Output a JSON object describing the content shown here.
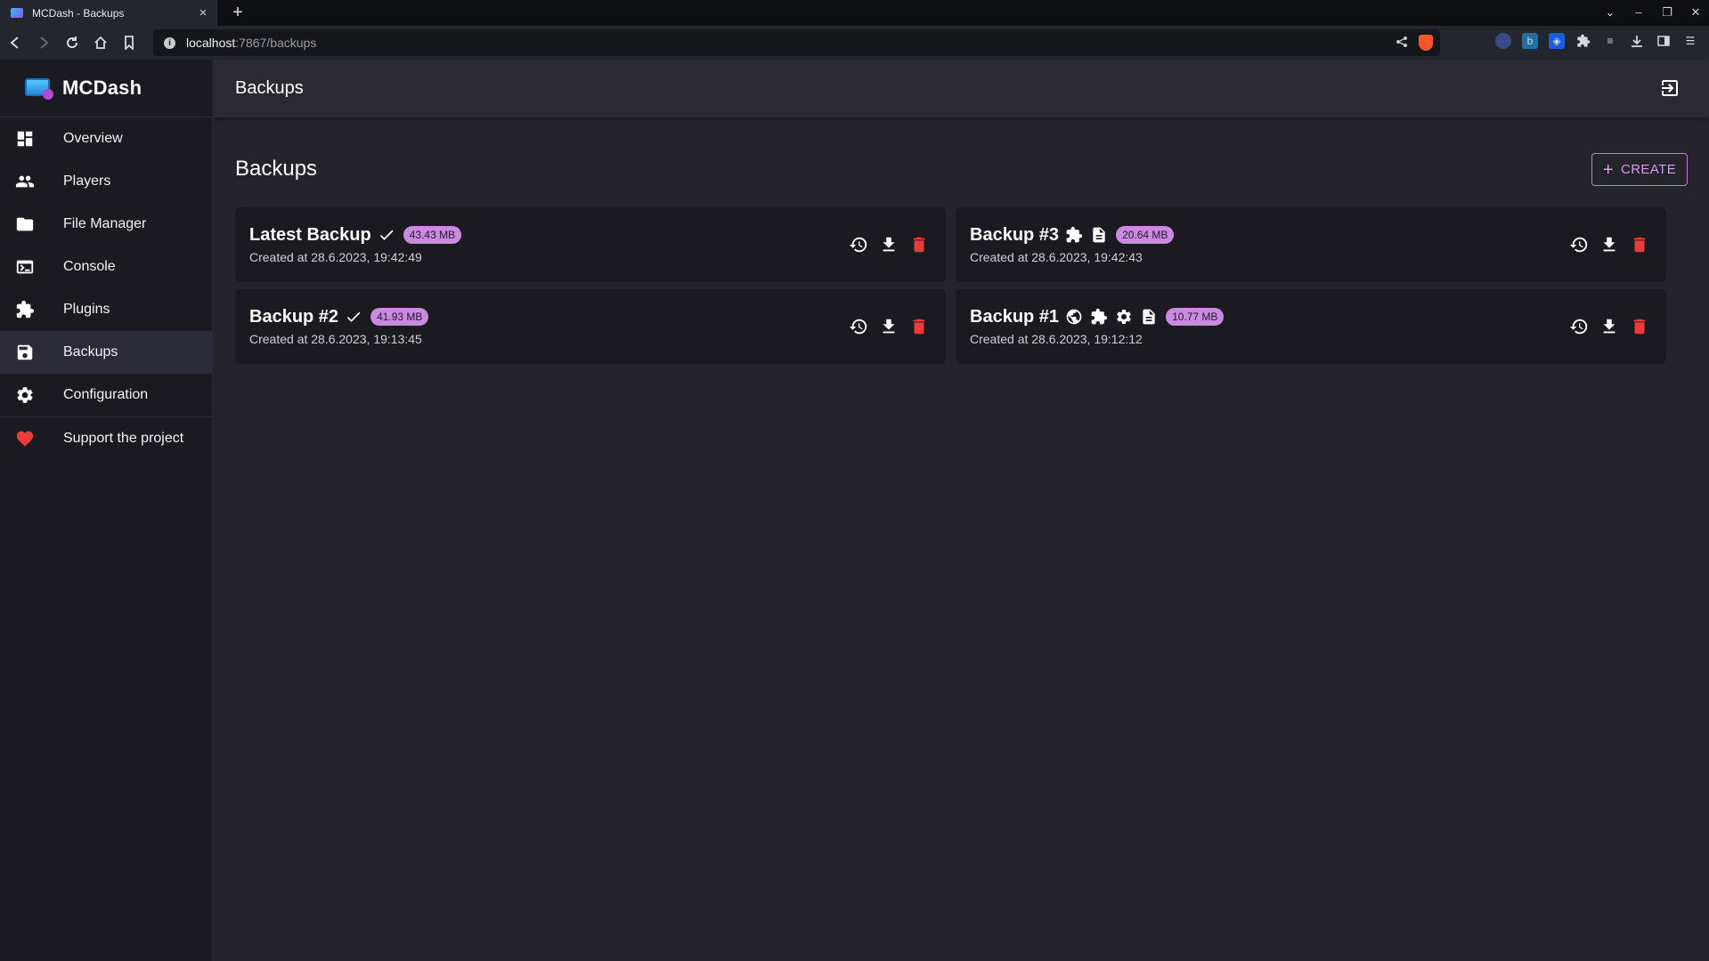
{
  "browser": {
    "tab_title": "MCDash - Backups",
    "tab_close": "×",
    "new_tab": "+",
    "url_host": "localhost",
    "url_path": ":7867/backups"
  },
  "sidebar": {
    "brand": "MCDash",
    "items": [
      {
        "label": "Overview",
        "icon": "dashboard-icon"
      },
      {
        "label": "Players",
        "icon": "players-icon"
      },
      {
        "label": "File Manager",
        "icon": "folder-icon"
      },
      {
        "label": "Console",
        "icon": "terminal-icon"
      },
      {
        "label": "Plugins",
        "icon": "puzzle-icon"
      },
      {
        "label": "Backups",
        "icon": "save-icon",
        "active": true
      },
      {
        "label": "Configuration",
        "icon": "gear-icon"
      }
    ],
    "support_label": "Support the project",
    "support_color": "#ef3a3a"
  },
  "topbar": {
    "title": "Backups"
  },
  "main": {
    "title": "Backups",
    "create_label": "CREATE",
    "create_plus": "+",
    "accent": "#c98ae0",
    "backups": [
      {
        "name": "Latest Backup",
        "icons": [
          "check-icon"
        ],
        "size": "43.43 MB",
        "created": "Created at 28.6.2023, 19:42:49"
      },
      {
        "name": "Backup #3",
        "icons": [
          "puzzle-icon",
          "file-icon"
        ],
        "size": "20.64 MB",
        "created": "Created at 28.6.2023, 19:42:43"
      },
      {
        "name": "Backup #2",
        "icons": [
          "check-icon"
        ],
        "size": "41.93 MB",
        "created": "Created at 28.6.2023, 19:13:45"
      },
      {
        "name": "Backup #1",
        "icons": [
          "globe-icon",
          "puzzle-icon",
          "gear-icon",
          "file-icon"
        ],
        "size": "10.77 MB",
        "created": "Created at 28.6.2023, 19:12:12"
      }
    ]
  }
}
